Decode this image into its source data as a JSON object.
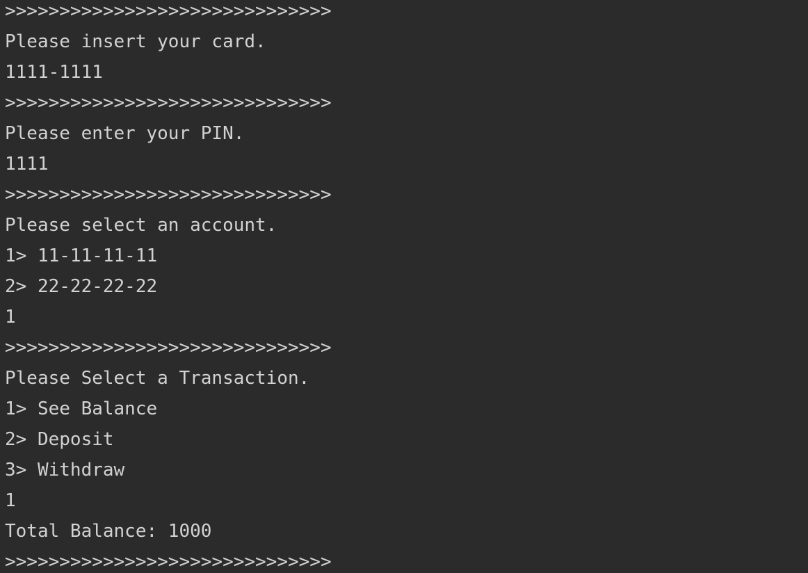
{
  "console": {
    "lines": [
      ">>>>>>>>>>>>>>>>>>>>>>>>>>>>>>",
      "Please insert your card.",
      "1111-1111",
      ">>>>>>>>>>>>>>>>>>>>>>>>>>>>>>",
      "Please enter your PIN.",
      "1111",
      ">>>>>>>>>>>>>>>>>>>>>>>>>>>>>>",
      "Please select an account.",
      "1> 11-11-11-11",
      "2> 22-22-22-22",
      "1",
      ">>>>>>>>>>>>>>>>>>>>>>>>>>>>>>",
      "Please Select a Transaction.",
      "1> See Balance",
      "2> Deposit",
      "3> Withdraw",
      "1",
      "Total Balance: 1000",
      ">>>>>>>>>>>>>>>>>>>>>>>>>>>>>>"
    ],
    "colors": {
      "background": "#2b2b2b",
      "text": "#d2d2d2"
    }
  }
}
